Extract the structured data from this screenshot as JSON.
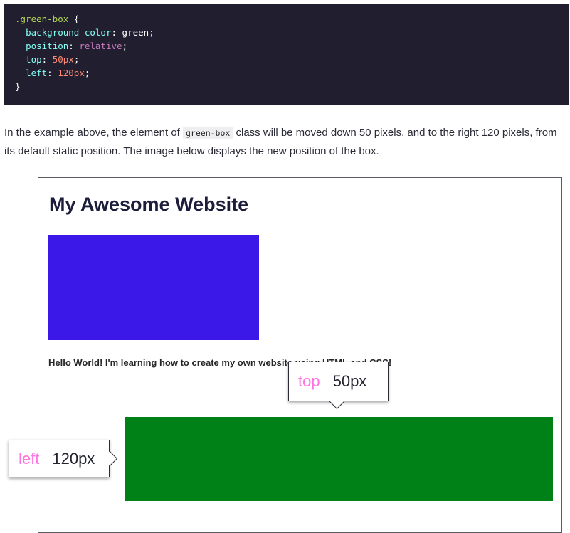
{
  "code": {
    "selector": ".green-box",
    "open_brace": " {",
    "lines": [
      {
        "prop": "background-color",
        "value": "green",
        "value_kind": "plain"
      },
      {
        "prop": "position",
        "value": "relative",
        "value_kind": "keyword"
      },
      {
        "prop": "top",
        "value": "50px",
        "value_kind": "number"
      },
      {
        "prop": "left",
        "value": "120px",
        "value_kind": "number"
      }
    ],
    "close_brace": "}"
  },
  "paragraph": {
    "before": "In the example above, the element of ",
    "inline_code": "green-box",
    "after": " class will be moved down 50 pixels, and to the right 120 pixels, from its default static position. The image below displays the new position of the box."
  },
  "illustration": {
    "site_title": "My Awesome Website",
    "hello_text": "Hello World! I'm learning how to create my own website using HTML and CSS!",
    "callout_top": {
      "key": "top",
      "value": "50px"
    },
    "callout_left": {
      "key": "left",
      "value": "120px"
    }
  },
  "colors": {
    "code_background": "#211f2f",
    "blue_box": "#3b17e8",
    "green_box": "#008118",
    "callout_key": "#ff73e3"
  }
}
